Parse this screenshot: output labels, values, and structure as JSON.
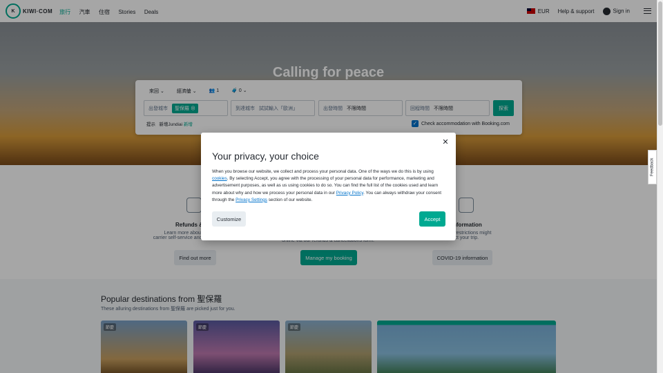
{
  "header": {
    "logo": "KIWI·COM",
    "nav": [
      "旅行",
      "汽車",
      "住宿",
      "Stories",
      "Deals"
    ],
    "currency": "EUR",
    "help": "Help & support",
    "signin": "Sign in"
  },
  "hero": {
    "title": "Calling for peace"
  },
  "search": {
    "trip_type": "來回",
    "cabin": "經濟艙",
    "passengers": "1",
    "bags": "0",
    "from_label": "出發城市",
    "from_chip": "聖保羅",
    "to_label": "到達城市",
    "to_placeholder": "試試輸入「歐洲」",
    "depart_label": "出發時間",
    "depart_value": "不限時間",
    "return_label": "回程時間",
    "return_value": "不限時間",
    "go": "探索",
    "hint_label": "提示",
    "hint_city": "新增Jundiai",
    "hint_add": "新增",
    "accommodation": "Check accommodation with Booking.com"
  },
  "info": {
    "c1_title": "Refunds & can",
    "c1_text1": "Learn more about our numer",
    "c1_text2": "carrier self-service and instant refunds.",
    "c1_btn": "Find out more",
    "c2_text": "online via our refunds & cancellations form.",
    "c2_btn": "Manage my booking",
    "c3_title": "us information",
    "c3_text1": "ew travel restrictions might",
    "c3_text2": "affect your trip.",
    "c3_btn": "COVID-19 information"
  },
  "destinations": {
    "title": "Popular destinations from 聖保羅",
    "subtitle": "These alluring destinations from 聖保羅 are picked just for you.",
    "tag": "節慶"
  },
  "modal": {
    "title": "Your privacy, your choice",
    "p1": "When you browse our website, we collect and process your personal data. One of the ways we do this is by using",
    "cookies_link": "cookies",
    "p2": ". By selecting Accept, you agree with the processing of your personal data for performance, marketing and advertisement purposes, as well as us using cookies to do so. You can find the full list of the cookies used and learn more about why and how we process your personal data in our",
    "policy_link": "Privacy Policy",
    "p3": ". You can always withdraw your consent through the",
    "settings_link": "Privacy Settings",
    "p4": "section of our website.",
    "customize": "Customize",
    "accept": "Accept"
  },
  "feedback": "Feedback"
}
